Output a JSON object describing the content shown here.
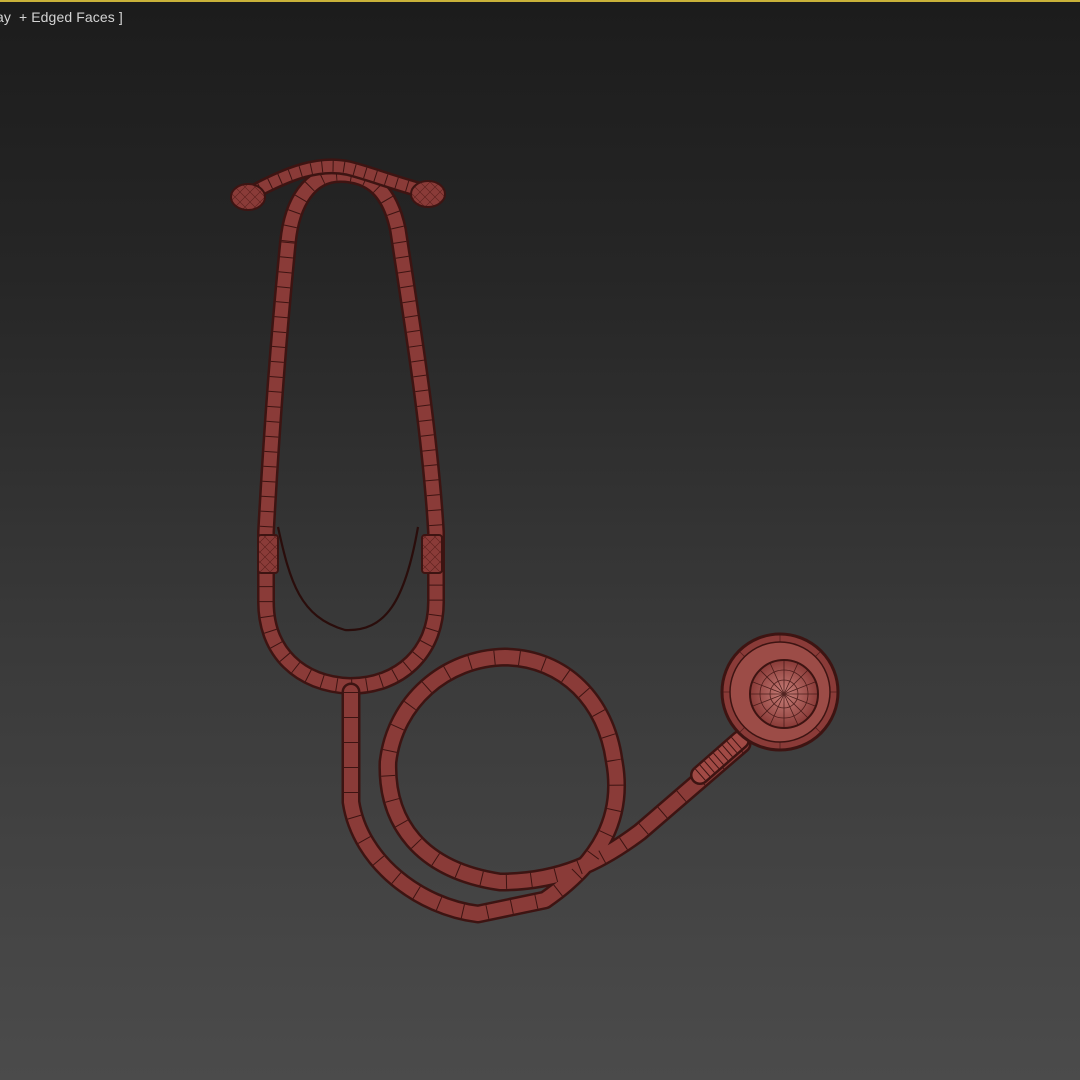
{
  "viewport": {
    "label": "ay  + Edged Faces ]",
    "colors": {
      "frame_highlight": "#c9b23a",
      "model_fill": "#8a3b38",
      "model_edge": "#3d1412",
      "model_light": "#b86a64"
    }
  },
  "model": {
    "name_icon": "stethoscope-icon"
  }
}
